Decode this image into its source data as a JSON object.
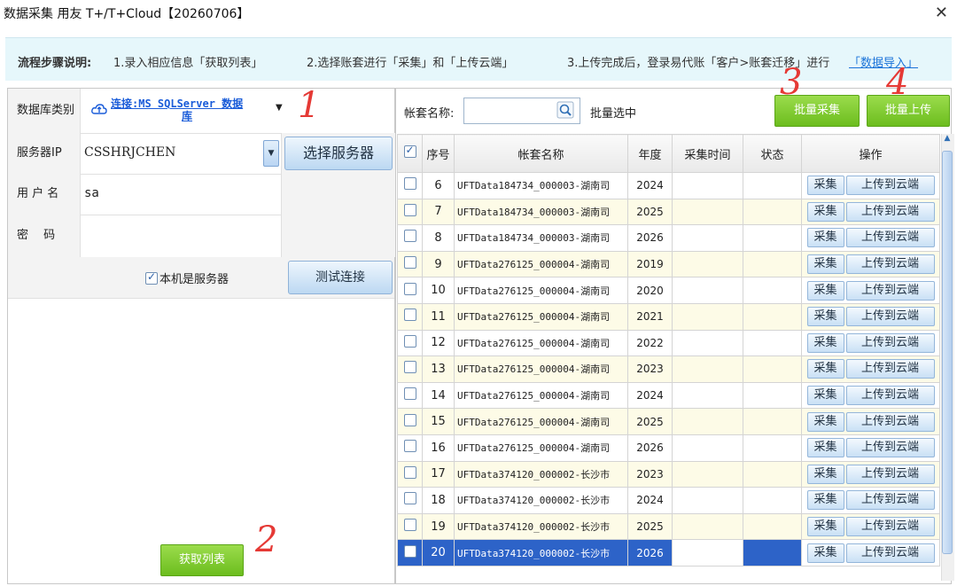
{
  "window": {
    "title": "数据采集 用友 T+/T+Cloud【20260706】",
    "close": "✕"
  },
  "steps": {
    "title": "流程步骤说明:",
    "step1": "1.录入相应信息「获取列表」",
    "step2": "2.选择账套进行「采集」和「上传云端」",
    "step3": "3.上传完成后，登录易代账「客户>账套迁移」进行",
    "step3_link": "「数据导入」"
  },
  "form": {
    "db_type_label": "数据库类别",
    "db_type_value_line1": "连接:MS SQLServer 数据",
    "db_type_value_line2": "库",
    "server_ip_label": "服务器IP",
    "server_ip_value": "CSSHRJCHEN",
    "select_server_btn": "选择服务器",
    "username_label": "用 户 名",
    "username_value": "sa",
    "password_label": "密　 码",
    "password_value": "",
    "local_server_checkbox": "本机是服务器",
    "test_conn_btn": "测试连接",
    "get_list_btn": "获取列表"
  },
  "toolbar": {
    "account_name_label": "帐套名称:",
    "account_name_value": "",
    "batch_select_label": "批量选中",
    "batch_collect_btn": "批量采集",
    "batch_upload_btn": "批量上传"
  },
  "annotations": {
    "a1": "1",
    "a2": "2",
    "a3": "3",
    "a4": "4"
  },
  "table": {
    "headers": {
      "seq": "序号",
      "name": "帐套名称",
      "year": "年度",
      "collect_time": "采集时间",
      "status": "状态",
      "ops": "操作"
    },
    "collect_label": "采集",
    "upload_label": "上传到云端",
    "rows": [
      {
        "seq": "6",
        "name": "UFTData184734_000003-湖南司",
        "year": "2024"
      },
      {
        "seq": "7",
        "name": "UFTData184734_000003-湖南司",
        "year": "2025"
      },
      {
        "seq": "8",
        "name": "UFTData184734_000003-湖南司",
        "year": "2026"
      },
      {
        "seq": "9",
        "name": "UFTData276125_000004-湖南司",
        "year": "2019"
      },
      {
        "seq": "10",
        "name": "UFTData276125_000004-湖南司",
        "year": "2020"
      },
      {
        "seq": "11",
        "name": "UFTData276125_000004-湖南司",
        "year": "2021"
      },
      {
        "seq": "12",
        "name": "UFTData276125_000004-湖南司",
        "year": "2022"
      },
      {
        "seq": "13",
        "name": "UFTData276125_000004-湖南司",
        "year": "2023"
      },
      {
        "seq": "14",
        "name": "UFTData276125_000004-湖南司",
        "year": "2024"
      },
      {
        "seq": "15",
        "name": "UFTData276125_000004-湖南司",
        "year": "2025"
      },
      {
        "seq": "16",
        "name": "UFTData276125_000004-湖南司",
        "year": "2026"
      },
      {
        "seq": "17",
        "name": "UFTData374120_000002-长沙市",
        "year": "2023"
      },
      {
        "seq": "18",
        "name": "UFTData374120_000002-长沙市",
        "year": "2024"
      },
      {
        "seq": "19",
        "name": "UFTData374120_000002-长沙市",
        "year": "2025"
      },
      {
        "seq": "20",
        "name": "UFTData374120_000002-长沙市",
        "year": "2026"
      }
    ]
  }
}
